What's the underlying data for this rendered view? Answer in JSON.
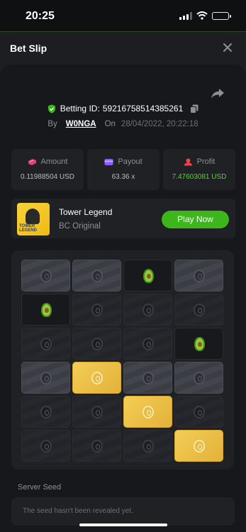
{
  "status_bar": {
    "time": "20:25"
  },
  "sheet": {
    "title": "Bet Slip"
  },
  "bet": {
    "betting_id_label": "Betting ID:",
    "betting_id": "59216758514385261",
    "by_label": "By",
    "user": "W0NGA",
    "on_label": "On",
    "date": "28/04/2022, 20:22:18"
  },
  "stats": {
    "amount_label": "Amount",
    "amount_value": "0.11988504 USD",
    "payout_label": "Payout",
    "payout_value": "63.36 x",
    "profit_label": "Profit",
    "profit_value": "7.47603081 USD",
    "colors": {
      "amount_icon": "#e0407a",
      "payout_icon": "#8b5cf6",
      "profit_icon": "#ef4444",
      "profit_value": "#56d22a"
    }
  },
  "game": {
    "name": "Tower Legend",
    "provider": "BC Original",
    "play_label": "Play Now",
    "thumb_text_line1": "TOWER",
    "thumb_text_line2": "LEGEND"
  },
  "board": {
    "rows": 6,
    "cols": 4,
    "tiles": [
      [
        "lit-coin",
        "lit-coin",
        "plain-avocado",
        "lit-coin"
      ],
      [
        "plain-avocado",
        "dark-coin",
        "dark-coin",
        "dark-coin"
      ],
      [
        "dark-coin",
        "dark-coin",
        "dark-coin",
        "plain-avocado"
      ],
      [
        "lit-coin",
        "gold-coin",
        "lit-coin",
        "lit-coin"
      ],
      [
        "dark-coin",
        "dark-coin",
        "gold-coin",
        "dark-coin"
      ],
      [
        "dark-coin",
        "dark-coin",
        "dark-coin",
        "gold-coin"
      ]
    ]
  },
  "seed": {
    "label": "Server Seed",
    "text": "The seed hasn't been revealed yet."
  },
  "colors": {
    "accent_green": "#3cb61a",
    "gold_tile": "#f4cd55"
  }
}
